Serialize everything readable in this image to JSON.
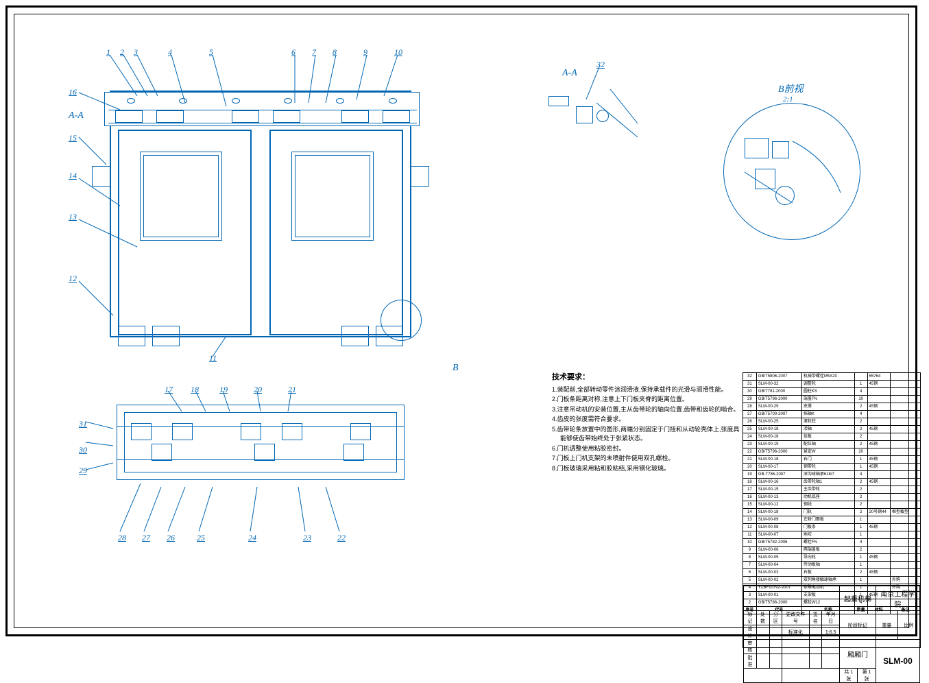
{
  "section_aa_label": "A-A",
  "detail_b_label": "B前视",
  "detail_b_scale": "2:1",
  "section_marker_left": "A-A",
  "detail_marker": "B",
  "balloons_main": [
    "1",
    "2",
    "3",
    "4",
    "5",
    "6",
    "7",
    "8",
    "9",
    "10",
    "11",
    "12",
    "13",
    "14",
    "15",
    "16"
  ],
  "balloons_top": [
    "17",
    "18",
    "19",
    "20",
    "21",
    "22",
    "23",
    "24",
    "25",
    "26",
    "27",
    "28",
    "29",
    "30",
    "31"
  ],
  "balloon_aa": "32",
  "tech_req": {
    "title": "技术要求：",
    "items": [
      "1.装配前,全部转动零件涂润滑液,保持承载件的光滑与润滑性能。",
      "2.门板条距离对称,注意上下门板夹脊的距离位置。",
      "3.注意吊动机的安装位置,主从齿带轮的轴向位置,齿带和齿轮的啮合。",
      "4.齿皮的张度需符合要求。",
      "5.齿带轮条放置中的图形,两端分别固定于门挂和从动轮壳体上,张度具能够使齿带始终处于张紧状态。",
      "6.门机调整使用粘胶密封。",
      "7.门板上门机支架的未喷射件使用双孔螺栓。",
      "8.门板玻璃采用粘和胶粘结,采用钢化玻璃。"
    ]
  },
  "bom_header": {
    "no": "序号",
    "code": "代号",
    "name": "名称",
    "qty": "数量",
    "mat": "材料",
    "remark": "备注"
  },
  "bom": [
    {
      "n": "32",
      "c": "GB/T5806-2007",
      "d": "机械带螺栓M5X20",
      "q": "",
      "m": "65764",
      "r": ""
    },
    {
      "n": "31",
      "c": "SLM-00-32",
      "d": "调整轮",
      "q": "1",
      "m": "45钢",
      "r": ""
    },
    {
      "n": "30",
      "c": "GB/T781-2000",
      "d": "圆柱KS",
      "q": "4",
      "m": "",
      "r": ""
    },
    {
      "n": "29",
      "c": "GB/T5796-2000",
      "d": "端盖FN",
      "q": "10",
      "m": "",
      "r": ""
    },
    {
      "n": "28",
      "c": "SLM-00-29",
      "d": "支撑",
      "q": "2",
      "m": "45钢",
      "r": ""
    },
    {
      "n": "27",
      "c": "GB/T5700-2007",
      "d": "挡轴K",
      "q": "4",
      "m": "",
      "r": ""
    },
    {
      "n": "26",
      "c": "SLM-00-25",
      "d": "滚轮柱",
      "q": "2",
      "m": "",
      "r": ""
    },
    {
      "n": "25",
      "c": "SLM-00-18",
      "d": "活轴",
      "q": "2",
      "m": "45钢",
      "r": ""
    },
    {
      "n": "24",
      "c": "SLM-00-18",
      "d": "挂板",
      "q": "2",
      "m": "",
      "r": ""
    },
    {
      "n": "23",
      "c": "SLM-00-19",
      "d": "配位轴",
      "q": "2",
      "m": "45钢",
      "r": ""
    },
    {
      "n": "22",
      "c": "GB/T5796-2000",
      "d": "紧定W",
      "q": "20",
      "m": "",
      "r": ""
    },
    {
      "n": "21",
      "c": "SLM-00-18",
      "d": "右门",
      "q": "1",
      "m": "45钢",
      "r": ""
    },
    {
      "n": "20",
      "c": "SLM-00-17",
      "d": "钢带轮",
      "q": "1",
      "m": "45钢",
      "r": ""
    },
    {
      "n": "19",
      "c": "GB-T786-2007",
      "d": "深沟球轴承618/7",
      "q": "4",
      "m": "",
      "r": ""
    },
    {
      "n": "18",
      "c": "SLM-00-16",
      "d": "齿带轮轴1",
      "q": "2",
      "m": "45钢",
      "r": ""
    },
    {
      "n": "17",
      "c": "SLM-00-15",
      "d": "主齿带轮",
      "q": "2",
      "m": "",
      "r": ""
    },
    {
      "n": "16",
      "c": "SLM-00-13",
      "d": "动机底座",
      "q": "2",
      "m": "",
      "r": ""
    },
    {
      "n": "15",
      "c": "SLM-00-12",
      "d": "钢线",
      "q": "2",
      "m": "",
      "r": ""
    },
    {
      "n": "14",
      "c": "SLM-00-18",
      "d": "门轨",
      "q": "2",
      "m": "20号钢44",
      "r": "框型截型"
    },
    {
      "n": "13",
      "c": "SLM-00-09",
      "d": "左轿门面板",
      "q": "1",
      "m": "",
      "r": ""
    },
    {
      "n": "12",
      "c": "SLM-00-08",
      "d": "门板条",
      "q": "1",
      "m": "45钢",
      "r": ""
    },
    {
      "n": "11",
      "c": "SLM-00-07",
      "d": "地坎",
      "q": "1",
      "m": "",
      "r": ""
    },
    {
      "n": "10",
      "c": "GB/T5782-2006",
      "d": "螺栓FN",
      "q": "4",
      "m": "",
      "r": ""
    },
    {
      "n": "9",
      "c": "SLM-00-06",
      "d": "两端盖板",
      "q": "2",
      "m": "",
      "r": ""
    },
    {
      "n": "8",
      "c": "SLM-00-05",
      "d": "导向轮",
      "q": "1",
      "m": "45钢",
      "r": ""
    },
    {
      "n": "7",
      "c": "SLM-00-04",
      "d": "传动板轴",
      "q": "1",
      "m": "",
      "r": ""
    },
    {
      "n": "6",
      "c": "SLM-00-03",
      "d": "右板",
      "q": "2",
      "m": "45钢",
      "r": ""
    },
    {
      "n": "5",
      "c": "SLM-00-02",
      "d": "双列角接触球轴承",
      "q": "1",
      "m": "",
      "r": "外购"
    },
    {
      "n": "4",
      "c": "YZBF10792-2007",
      "d": "永磁电动机",
      "q": "1",
      "m": "",
      "r": "外购"
    },
    {
      "n": "3",
      "c": "SLM-00-01",
      "d": "支架板",
      "q": "1",
      "m": "45钢",
      "r": ""
    },
    {
      "n": "2",
      "c": "GB/T5786-2000",
      "d": "螺栓W12",
      "q": "4",
      "m": "",
      "r": ""
    }
  ],
  "title_block": {
    "drawing_title1": "起重机梯",
    "drawing_title2": "厢厢门",
    "school": "南京工程学院",
    "dwg_no": "SLM-00",
    "mark": "标记",
    "qty": "处数",
    "zone": "分区",
    "file": "更改文件号",
    "sig": "签名",
    "date": "年月日",
    "design": "设计",
    "chk": "审核",
    "std": "标准化",
    "appr": "批准",
    "stage": "阶段标记",
    "wt": "重量",
    "scale": "比例",
    "sheet": "共 1 张",
    "page": "第 1 张",
    "scale_val": "1:6.5"
  }
}
